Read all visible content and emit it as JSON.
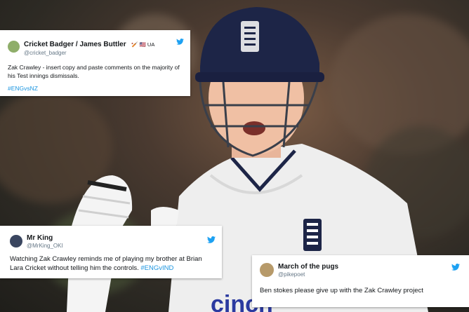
{
  "tweets": [
    {
      "name": "Cricket Badger / James Buttler",
      "name_suffix": "🏏 🇺🇸 UA",
      "handle": "@cricket_badger",
      "text": "Zak Crawley - insert copy and paste comments on the majority of his Test innings dismissals.",
      "hashtag": "#ENGvsNZ",
      "avatar_color": "#8fae6a"
    },
    {
      "name": "Mr King",
      "handle": "@MrKing_OKI",
      "text": "Watching Zak Crawley reminds me of playing my brother at Brian Lara Cricket without telling him the controls.",
      "hashtag": "#ENGvIND",
      "avatar_color": "#3a4660"
    },
    {
      "name": "March of the pugs",
      "handle": "@pikepoet",
      "text": "Ben stokes please give up with the Zak Crawley project",
      "avatar_color": "#b79a6a"
    }
  ],
  "photo": {
    "shirt_sponsor": "cinch"
  },
  "colors": {
    "twitter_blue": "#1da1f2",
    "hashtag": "#1b95e0",
    "helmet": "#1d2547"
  }
}
